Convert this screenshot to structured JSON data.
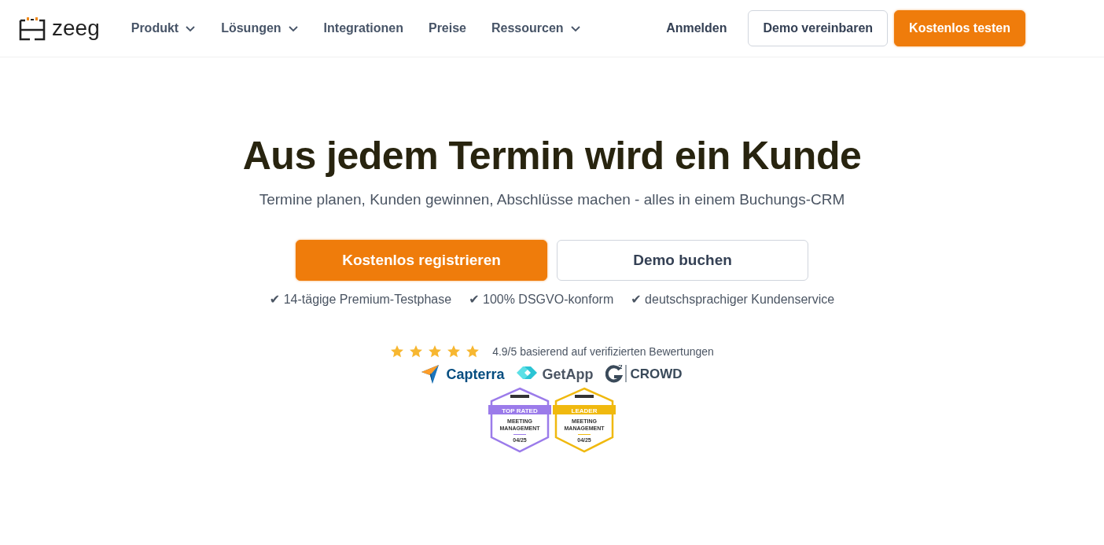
{
  "header": {
    "logo": "zeeg",
    "nav": [
      {
        "label": "Produkt",
        "has_menu": true
      },
      {
        "label": "Lösungen",
        "has_menu": true
      },
      {
        "label": "Integrationen",
        "has_menu": false
      },
      {
        "label": "Preise",
        "has_menu": false
      },
      {
        "label": "Ressourcen",
        "has_menu": true
      }
    ],
    "login": "Anmelden",
    "buttons": [
      {
        "label": "Demo vereinbaren",
        "kind": "secondary"
      },
      {
        "label": "Kostenlos testen",
        "kind": "primary"
      }
    ]
  },
  "hero": {
    "title": "Aus jedem Termin wird ein Kunde",
    "subtitle": "Termine planen, Kunden gewinnen, Abschlüsse machen - alles in einem Buchungs-CRM",
    "buttons": [
      {
        "label": "Kostenlos registrieren",
        "kind": "primary"
      },
      {
        "label": "Demo buchen",
        "kind": "secondary"
      }
    ],
    "features": [
      "✔ 14-tägige Premium-Testphase",
      "✔ 100% DSGVO-konform",
      "✔ deutschsprachiger Kundenservice"
    ],
    "rating": {
      "stars": 5,
      "text": "4.9/5 basierend auf verifizierten Bewertungen"
    },
    "review_sites": [
      {
        "name": "Capterra",
        "kind": "capterra"
      },
      {
        "name": "GetApp",
        "kind": "getapp"
      },
      {
        "name": "CROWD",
        "kind": "g2"
      }
    ],
    "badges": [
      {
        "label": "TOP RATED",
        "category": "MEETING MANAGEMENT",
        "date": "04/25",
        "color": "#9b7bea"
      },
      {
        "label": "LEADER",
        "category": "MEETING MANAGEMENT",
        "date": "04/25",
        "color": "#f0b90f"
      }
    ]
  }
}
